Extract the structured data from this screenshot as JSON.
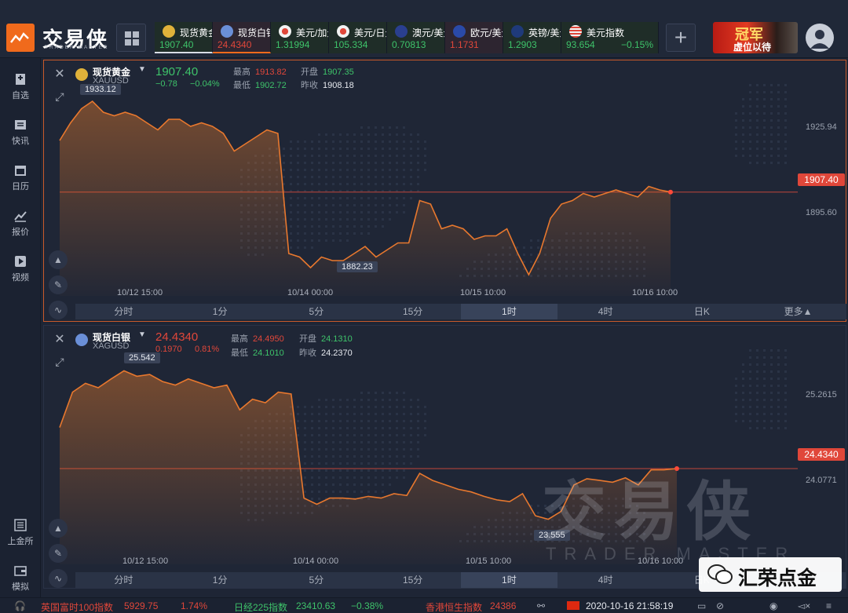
{
  "app": {
    "name": "交易侠",
    "subtitle": "TRADER MASTER"
  },
  "tickers": [
    {
      "name": "现货黄金",
      "value": "1907.40",
      "change": "",
      "color": "#3ec36a",
      "icon": "gold-coin-icon"
    },
    {
      "name": "现货白银",
      "value": "24.4340",
      "change": "",
      "color": "#e0473a",
      "icon": "silver-coin-icon"
    },
    {
      "name": "美元/加元",
      "value": "1.31994",
      "change": "",
      "color": "#3ec36a",
      "icon": "flag-icon"
    },
    {
      "name": "美元/日元",
      "value": "105.334",
      "change": "",
      "color": "#3ec36a",
      "icon": "flag-icon"
    },
    {
      "name": "澳元/美元",
      "value": "0.70813",
      "change": "",
      "color": "#3ec36a",
      "icon": "flag-icon"
    },
    {
      "name": "欧元/美元",
      "value": "1.1731",
      "change": "",
      "color": "#e0473a",
      "icon": "flag-icon"
    },
    {
      "name": "英镑/美元",
      "value": "1.2903",
      "change": "",
      "color": "#3ec36a",
      "icon": "flag-icon"
    },
    {
      "name": "美元指数",
      "value": "93.654",
      "change": "−0.15%",
      "color": "#3ec36a",
      "icon": "us-flag-icon"
    }
  ],
  "banner": {
    "big": "冠军",
    "small": "虚位以待"
  },
  "sidebar": [
    {
      "label": "自选",
      "icon": "bookmark-icon"
    },
    {
      "label": "快讯",
      "icon": "news-icon"
    },
    {
      "label": "日历",
      "icon": "calendar-icon"
    },
    {
      "label": "报价",
      "icon": "chart-line-icon"
    },
    {
      "label": "视频",
      "icon": "play-icon"
    },
    {
      "label": "上金所",
      "icon": "exchange-icon"
    },
    {
      "label": "模拟",
      "icon": "wallet-icon"
    }
  ],
  "panels": [
    {
      "name": "现货黄金",
      "symbol": "XAUUSD",
      "price": "1907.40",
      "change": "−0.78",
      "change_pct": "−0.04%",
      "price_color": "#3ec36a",
      "high_label": "最高",
      "high": "1913.82",
      "low_label": "最低",
      "low": "1902.72",
      "open_label": "开盘",
      "open": "1907.35",
      "prev_label": "昨收",
      "prev": "1908.18",
      "price_tag": "1907.40",
      "max_callout": "1933.12",
      "min_callout": "1882.23",
      "yticks": [
        "1925.94",
        "1895.60"
      ],
      "xticks": [
        "10/12 15:00",
        "10/14 00:00",
        "10/15 10:00",
        "10/16 10:00"
      ]
    },
    {
      "name": "现货白银",
      "symbol": "XAGUSD",
      "price": "24.4340",
      "change": "0.1970",
      "change_pct": "0.81%",
      "price_color": "#e0473a",
      "high_label": "最高",
      "high": "24.4950",
      "low_label": "最低",
      "low": "24.1010",
      "open_label": "开盘",
      "open": "24.1310",
      "prev_label": "昨收",
      "prev": "24.2370",
      "price_tag": "24.4340",
      "max_callout": "25.542",
      "min_callout": "23.555",
      "yticks": [
        "25.2615",
        "24.0771"
      ],
      "xticks": [
        "10/12 15:00",
        "10/14 00:00",
        "10/15 10:00",
        "10/16 10:00"
      ]
    }
  ],
  "timeframes": [
    "分时",
    "1分",
    "5分",
    "15分",
    "1时",
    "4时",
    "日K",
    "更多▲"
  ],
  "timeframes2": [
    "分时",
    "1分",
    "5分",
    "15分",
    "1时",
    "4时",
    "日K"
  ],
  "watermark": {
    "main": "交易侠",
    "sub": "TRADER MASTER"
  },
  "wechat": {
    "label": "汇荣点金"
  },
  "bottombar": {
    "items": [
      {
        "name": "英国富时100指数",
        "value": "5929.75",
        "change": "1.74%",
        "dir": "down"
      },
      {
        "name": "日经225指数",
        "value": "23410.63",
        "change": "−0.38%",
        "dir": "up"
      },
      {
        "name": "香港恒生指数",
        "value": "24386",
        "change": "",
        "dir": "down"
      }
    ],
    "datetime": "2020-10-16 21:58:19"
  },
  "chart_data": [
    {
      "type": "area",
      "title": "现货黄金 XAUUSD",
      "categories": [
        "10/12 15:00",
        "10/14 00:00",
        "10/15 10:00",
        "10/16 10:00"
      ],
      "series": [
        {
          "name": "XAUUSD",
          "values": [
            1922,
            1927,
            1931,
            1933.12,
            1930,
            1929,
            1930,
            1929,
            1927,
            1925,
            1928,
            1928,
            1926,
            1927,
            1926,
            1924,
            1919,
            1921,
            1923,
            1925,
            1924,
            1890,
            1889,
            1886,
            1889,
            1888,
            1888,
            1890,
            1892,
            1889,
            1891,
            1893,
            1893,
            1905,
            1904,
            1897,
            1898,
            1897,
            1894,
            1895,
            1895,
            1897,
            1890,
            1884,
            1890,
            1900,
            1904,
            1905,
            1907,
            1906,
            1907,
            1908,
            1907,
            1906,
            1909,
            1908,
            1907.4
          ]
        }
      ],
      "ylim": [
        1878,
        1938
      ],
      "price_line": 1907.4
    },
    {
      "type": "area",
      "title": "现货白银 XAGUSD",
      "categories": [
        "10/12 15:00",
        "10/14 00:00",
        "10/15 10:00",
        "10/16 10:00"
      ],
      "series": [
        {
          "name": "XAGUSD",
          "values": [
            24.9,
            25.3,
            25.4,
            25.35,
            25.45,
            25.542,
            25.48,
            25.5,
            25.42,
            25.38,
            25.45,
            25.4,
            25.35,
            25.38,
            25.1,
            25.22,
            25.18,
            25.3,
            25.28,
            24.1,
            24.03,
            24.1,
            24.1,
            24.09,
            24.12,
            24.1,
            24.15,
            24.13,
            24.38,
            24.3,
            24.25,
            24.2,
            24.17,
            24.12,
            24.08,
            24.06,
            24.15,
            23.9,
            23.86,
            23.95,
            24.25,
            24.32,
            24.3,
            24.28,
            24.33,
            24.25,
            24.42,
            24.42,
            24.434
          ]
        }
      ],
      "ylim": [
        23.35,
        25.75
      ],
      "price_line": 24.434
    }
  ]
}
